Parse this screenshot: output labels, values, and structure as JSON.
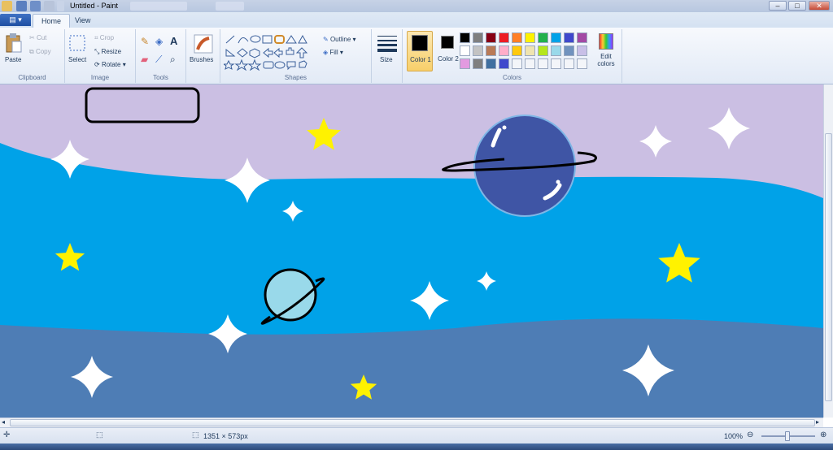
{
  "window": {
    "title": "Untitled - Paint"
  },
  "file_menu": {
    "icon": "paint-menu-icon"
  },
  "tabs": [
    {
      "label": "Home"
    },
    {
      "label": "View"
    }
  ],
  "ribbon": {
    "clipboard": {
      "label": "Clipboard",
      "paste": "Paste",
      "cut": "Cut",
      "copy": "Copy"
    },
    "image": {
      "label": "Image",
      "select": "Select",
      "crop": "Crop",
      "resize": "Resize",
      "rotate": "Rotate"
    },
    "tools": {
      "label": "Tools"
    },
    "brushes": {
      "label": "Brushes"
    },
    "shapes": {
      "label": "Shapes",
      "outline": "Outline",
      "fill": "Fill"
    },
    "size": {
      "label": "Size"
    },
    "colors": {
      "label": "Colors",
      "color1": "Color 1",
      "color2": "Color 2",
      "edit": "Edit colors",
      "color1_value": "#000000",
      "color2_value": "#000000",
      "palette_row1": [
        "#000000",
        "#7f7f7f",
        "#880015",
        "#ed1c24",
        "#ff7f27",
        "#fff200",
        "#22b14c",
        "#00a2e8",
        "#3f48cc",
        "#a349a4"
      ],
      "palette_row2": [
        "#ffffff",
        "#c3c3c3",
        "#b97a57",
        "#ffaec9",
        "#ffc90e",
        "#efe4b0",
        "#b5e61d",
        "#99d9ea",
        "#7092be",
        "#c8bfe7"
      ],
      "palette_row3": [
        "#e39ae0",
        "#7f7f7f",
        "#3f6fa0",
        "#3f48cc",
        "",
        "",
        "",
        "",
        "",
        ""
      ]
    }
  },
  "status": {
    "canvas_size": "1351 × 573px",
    "zoom": "100%"
  },
  "colors": {
    "sky": "#cbbfe3",
    "sea": "#00a2e8",
    "deep": "#4e7db5",
    "star_yellow": "#fff200",
    "star_white": "#ffffff",
    "planet_big": "#3f55a5",
    "planet_small": "#99d9ea"
  }
}
